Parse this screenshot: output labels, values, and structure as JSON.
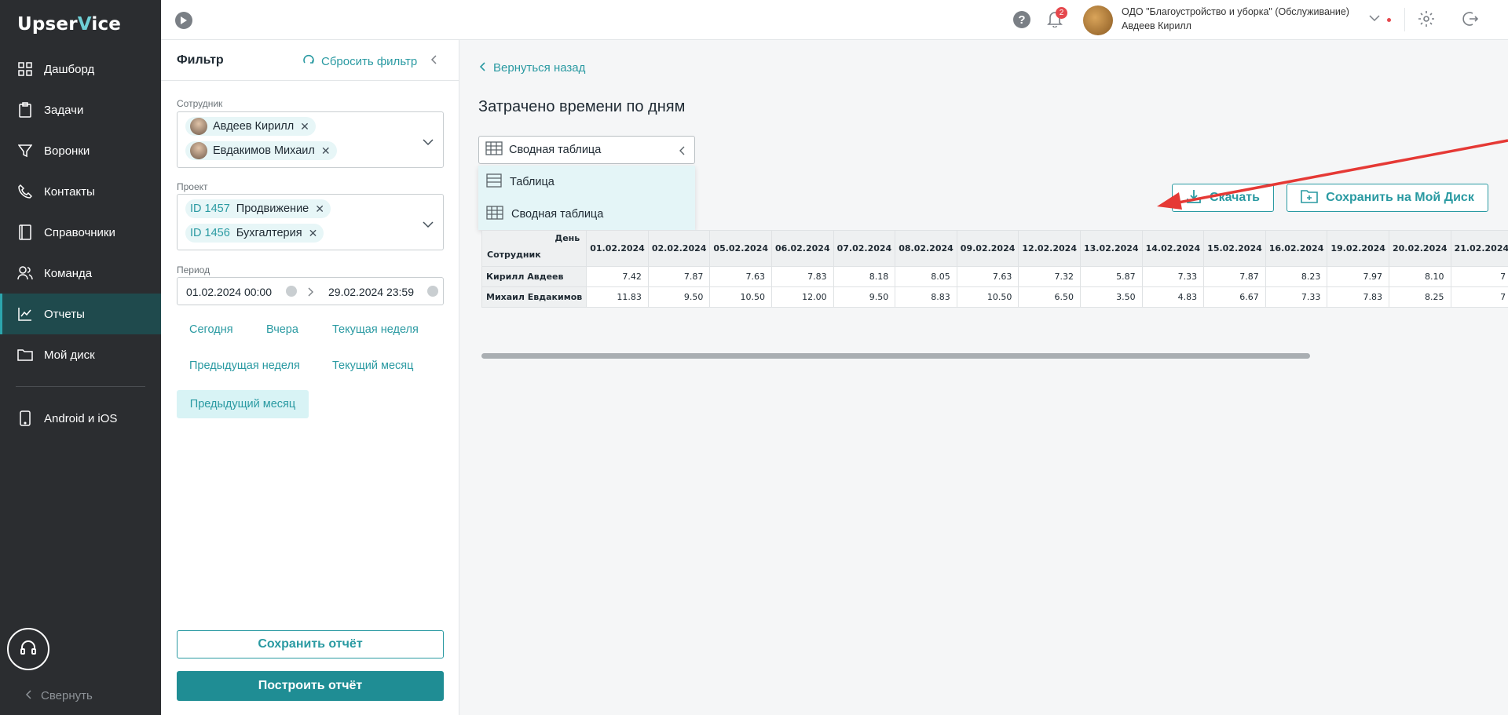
{
  "app": {
    "logo_pre": "Upser",
    "logo_accent": "V",
    "logo_post": "ice"
  },
  "sidebar": {
    "items": [
      {
        "label": "Дашборд",
        "icon": "grid-icon"
      },
      {
        "label": "Задачи",
        "icon": "clipboard-icon"
      },
      {
        "label": "Воронки",
        "icon": "funnel-icon"
      },
      {
        "label": "Контакты",
        "icon": "phone-icon"
      },
      {
        "label": "Справочники",
        "icon": "book-icon"
      },
      {
        "label": "Команда",
        "icon": "users-icon"
      },
      {
        "label": "Отчеты",
        "icon": "chart-icon",
        "active": true
      },
      {
        "label": "Мой диск",
        "icon": "folder-icon"
      }
    ],
    "mobile": "Android и iOS",
    "collapse": "Свернуть"
  },
  "header": {
    "notifications": "2",
    "org": "ОДО \"Благоустройство и уборка\" (Обслуживание)",
    "user": "Авдеев Кирилл"
  },
  "filter": {
    "title": "Фильтр",
    "reset": "Сбросить фильтр",
    "employee_label": "Сотрудник",
    "employees": [
      "Авдеев Кирилл",
      "Евдакимов Михаил"
    ],
    "project_label": "Проект",
    "projects": [
      {
        "id": "ID 1457",
        "name": "Продвижение"
      },
      {
        "id": "ID 1456",
        "name": "Бухгалтерия"
      }
    ],
    "period_label": "Период",
    "date_from": "01.02.2024 00:00",
    "date_to": "29.02.2024 23:59",
    "quick": {
      "today": "Сегодня",
      "yesterday": "Вчера",
      "this_week": "Текущая неделя",
      "prev_week": "Предыдущая неделя",
      "this_month": "Текущий месяц",
      "prev_month": "Предыдущий месяц"
    },
    "save_btn": "Сохранить отчёт",
    "build_btn": "Построить отчёт"
  },
  "main": {
    "back": "Вернуться назад",
    "title": "Затрачено времени по дням",
    "view_selected": "Сводная таблица",
    "view_options": [
      "Таблица",
      "Сводная таблица"
    ],
    "download": "Скачать",
    "save_disk": "Сохранить на Мой Диск"
  },
  "table": {
    "corner_day": "День",
    "corner_emp": "Сотрудник",
    "dates": [
      "01.02.2024",
      "02.02.2024",
      "05.02.2024",
      "06.02.2024",
      "07.02.2024",
      "08.02.2024",
      "09.02.2024",
      "12.02.2024",
      "13.02.2024",
      "14.02.2024",
      "15.02.2024",
      "16.02.2024",
      "19.02.2024",
      "20.02.2024",
      "21.02.2024"
    ],
    "rows": [
      {
        "name": "Кирилл Авдеев",
        "values": [
          "7.42",
          "7.87",
          "7.63",
          "7.83",
          "8.18",
          "8.05",
          "7.63",
          "7.32",
          "5.87",
          "7.33",
          "7.87",
          "8.23",
          "7.97",
          "8.10",
          "7"
        ]
      },
      {
        "name": "Михаил Евдакимов",
        "values": [
          "11.83",
          "9.50",
          "10.50",
          "12.00",
          "9.50",
          "8.83",
          "10.50",
          "6.50",
          "3.50",
          "4.83",
          "6.67",
          "7.33",
          "7.83",
          "8.25",
          "7"
        ]
      }
    ]
  },
  "colors": {
    "accent": "#2a9aa2",
    "sidebar": "#2b2d30",
    "arrow": "#e53935"
  }
}
